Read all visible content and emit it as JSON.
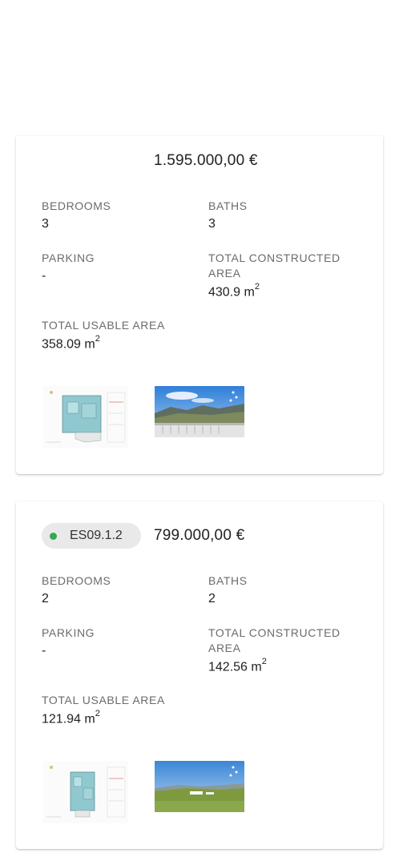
{
  "listings": [
    {
      "price": "1.595.000,00 €",
      "reference": "",
      "bedrooms_label": "BEDROOMS",
      "bedrooms": "3",
      "baths_label": "BATHS",
      "baths": "3",
      "parking_label": "PARKING",
      "parking": "-",
      "constructed_label_1": "TOTAL CONSTRUCTED",
      "constructed_label_2": "AREA",
      "constructed": "430.9 m",
      "constructed_unit_exp": "2",
      "usable_label": "TOTAL USABLE AREA",
      "usable": "358.09 m",
      "usable_unit_exp": "2"
    },
    {
      "price": "799.000,00 €",
      "reference": "ES09.1.2",
      "status_color": "#34a853",
      "bedrooms_label": "BEDROOMS",
      "bedrooms": "2",
      "baths_label": "BATHS",
      "baths": "2",
      "parking_label": "PARKING",
      "parking": "-",
      "constructed_label_1": "TOTAL CONSTRUCTED",
      "constructed_label_2": "AREA",
      "constructed": "142.56 m",
      "constructed_unit_exp": "2",
      "usable_label": "TOTAL USABLE AREA",
      "usable": "121.94 m",
      "usable_unit_exp": "2"
    }
  ]
}
